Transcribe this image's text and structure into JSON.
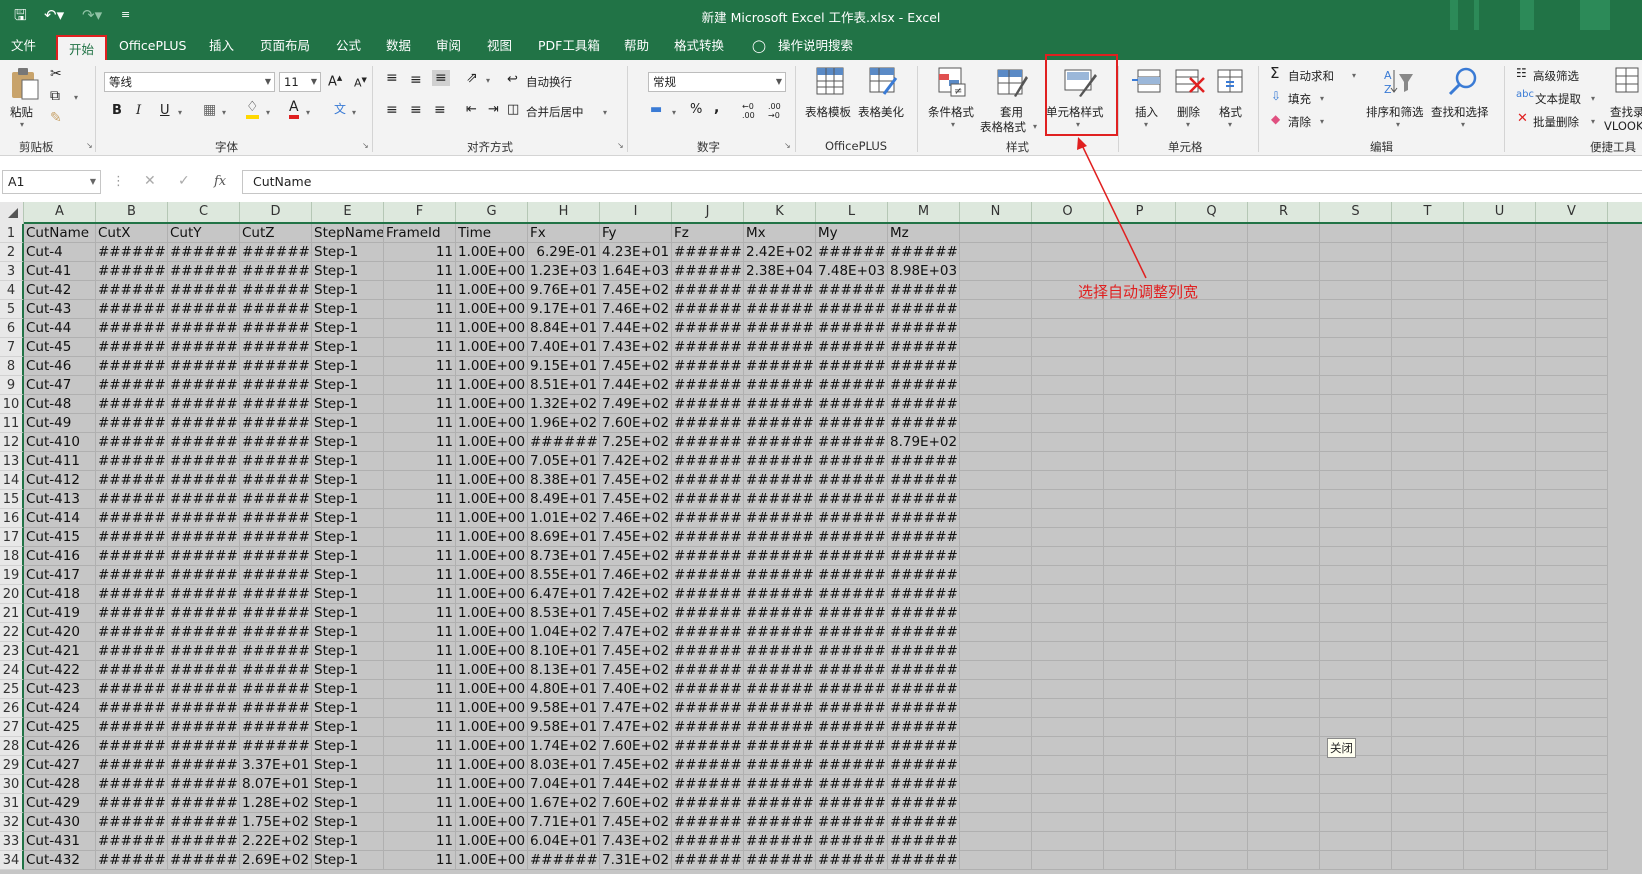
{
  "titlebar": {
    "title": "新建 Microsoft Excel 工作表.xlsx  -  Excel",
    "save_icon": "save-icon",
    "undo_icon": "undo-icon",
    "redo_icon": "redo-icon"
  },
  "tabs": [
    "文件",
    "开始",
    "OfficePLUS",
    "插入",
    "页面布局",
    "公式",
    "数据",
    "审阅",
    "视图",
    "PDF工具箱",
    "帮助",
    "格式转换"
  ],
  "tellme": "操作说明搜索",
  "ribbon": {
    "paste": "粘贴",
    "clipboard": "剪贴板",
    "font_name": "等线",
    "font_size": "11",
    "font_group": "字体",
    "wrap_text": "自动换行",
    "merge_center": "合并后居中",
    "align_group": "对齐方式",
    "number_format": "常规",
    "number_group": "数字",
    "table_template": "表格模板",
    "table_beautify": "表格美化",
    "officeplus_group": "OfficePLUS",
    "cond_format": "条件格式",
    "apply_format_1": "套用",
    "apply_format_2": "表格格式",
    "cell_styles": "单元格样式",
    "styles_group": "样式",
    "insert": "插入",
    "delete": "删除",
    "format": "格式",
    "cells_group": "单元格",
    "autosum": "自动求和",
    "fill": "填充",
    "clear": "清除",
    "sort_filter": "排序和筛选",
    "find_select": "查找和选择",
    "edit_group": "编辑",
    "adv_filter": "高级筛选",
    "text_extract": "文本提取",
    "batch_delete": "批量删除",
    "find_vlookup_1": "查找录",
    "find_vlookup_2": "VLOOK",
    "tools_group": "便捷工具"
  },
  "formula_bar": {
    "name_box": "A1",
    "fx_label": "fx",
    "content": "CutName"
  },
  "columns": [
    "A",
    "B",
    "C",
    "D",
    "E",
    "F",
    "G",
    "H",
    "I",
    "J",
    "K",
    "L",
    "M",
    "N",
    "O",
    "P",
    "Q",
    "R",
    "S",
    "T",
    "U",
    "V"
  ],
  "sheet": {
    "header": [
      "CutName",
      "CutX",
      "CutY",
      "CutZ",
      "StepName",
      "FrameId",
      "Time",
      "Fx",
      "Fy",
      "Fz",
      "Mx",
      "My",
      "Mz"
    ],
    "rows": [
      [
        "Cut-4",
        "#######",
        "#######",
        "#######",
        "Step-1",
        "11",
        "1.00E+00",
        "6.29E-01",
        "4.23E+01",
        "#######",
        "2.42E+02",
        "#######",
        "#######"
      ],
      [
        "Cut-41",
        "#######",
        "#######",
        "#######",
        "Step-1",
        "11",
        "1.00E+00",
        "1.23E+03",
        "1.64E+03",
        "#######",
        "2.38E+04",
        "7.48E+03",
        "8.98E+03"
      ],
      [
        "Cut-42",
        "#######",
        "#######",
        "#######",
        "Step-1",
        "11",
        "1.00E+00",
        "9.76E+01",
        "7.45E+02",
        "#######",
        "#######",
        "#######",
        "#######"
      ],
      [
        "Cut-43",
        "#######",
        "#######",
        "#######",
        "Step-1",
        "11",
        "1.00E+00",
        "9.17E+01",
        "7.46E+02",
        "#######",
        "#######",
        "#######",
        "#######"
      ],
      [
        "Cut-44",
        "#######",
        "#######",
        "#######",
        "Step-1",
        "11",
        "1.00E+00",
        "8.84E+01",
        "7.44E+02",
        "#######",
        "#######",
        "#######",
        "#######"
      ],
      [
        "Cut-45",
        "#######",
        "#######",
        "#######",
        "Step-1",
        "11",
        "1.00E+00",
        "7.40E+01",
        "7.43E+02",
        "#######",
        "#######",
        "#######",
        "#######"
      ],
      [
        "Cut-46",
        "#######",
        "#######",
        "#######",
        "Step-1",
        "11",
        "1.00E+00",
        "9.15E+01",
        "7.45E+02",
        "#######",
        "#######",
        "#######",
        "#######"
      ],
      [
        "Cut-47",
        "#######",
        "#######",
        "#######",
        "Step-1",
        "11",
        "1.00E+00",
        "8.51E+01",
        "7.44E+02",
        "#######",
        "#######",
        "#######",
        "#######"
      ],
      [
        "Cut-48",
        "#######",
        "#######",
        "#######",
        "Step-1",
        "11",
        "1.00E+00",
        "1.32E+02",
        "7.49E+02",
        "#######",
        "#######",
        "#######",
        "#######"
      ],
      [
        "Cut-49",
        "#######",
        "#######",
        "#######",
        "Step-1",
        "11",
        "1.00E+00",
        "1.96E+02",
        "7.60E+02",
        "#######",
        "#######",
        "#######",
        "#######"
      ],
      [
        "Cut-410",
        "#######",
        "#######",
        "#######",
        "Step-1",
        "11",
        "1.00E+00",
        "#######",
        "7.25E+02",
        "#######",
        "#######",
        "#######",
        "8.79E+02"
      ],
      [
        "Cut-411",
        "#######",
        "#######",
        "#######",
        "Step-1",
        "11",
        "1.00E+00",
        "7.05E+01",
        "7.42E+02",
        "#######",
        "#######",
        "#######",
        "#######"
      ],
      [
        "Cut-412",
        "#######",
        "#######",
        "#######",
        "Step-1",
        "11",
        "1.00E+00",
        "8.38E+01",
        "7.45E+02",
        "#######",
        "#######",
        "#######",
        "#######"
      ],
      [
        "Cut-413",
        "#######",
        "#######",
        "#######",
        "Step-1",
        "11",
        "1.00E+00",
        "8.49E+01",
        "7.45E+02",
        "#######",
        "#######",
        "#######",
        "#######"
      ],
      [
        "Cut-414",
        "#######",
        "#######",
        "#######",
        "Step-1",
        "11",
        "1.00E+00",
        "1.01E+02",
        "7.46E+02",
        "#######",
        "#######",
        "#######",
        "#######"
      ],
      [
        "Cut-415",
        "#######",
        "#######",
        "#######",
        "Step-1",
        "11",
        "1.00E+00",
        "8.69E+01",
        "7.45E+02",
        "#######",
        "#######",
        "#######",
        "#######"
      ],
      [
        "Cut-416",
        "#######",
        "#######",
        "#######",
        "Step-1",
        "11",
        "1.00E+00",
        "8.73E+01",
        "7.45E+02",
        "#######",
        "#######",
        "#######",
        "#######"
      ],
      [
        "Cut-417",
        "#######",
        "#######",
        "#######",
        "Step-1",
        "11",
        "1.00E+00",
        "8.55E+01",
        "7.46E+02",
        "#######",
        "#######",
        "#######",
        "#######"
      ],
      [
        "Cut-418",
        "#######",
        "#######",
        "#######",
        "Step-1",
        "11",
        "1.00E+00",
        "6.47E+01",
        "7.42E+02",
        "#######",
        "#######",
        "#######",
        "#######"
      ],
      [
        "Cut-419",
        "#######",
        "#######",
        "#######",
        "Step-1",
        "11",
        "1.00E+00",
        "8.53E+01",
        "7.45E+02",
        "#######",
        "#######",
        "#######",
        "#######"
      ],
      [
        "Cut-420",
        "#######",
        "#######",
        "#######",
        "Step-1",
        "11",
        "1.00E+00",
        "1.04E+02",
        "7.47E+02",
        "#######",
        "#######",
        "#######",
        "#######"
      ],
      [
        "Cut-421",
        "#######",
        "#######",
        "#######",
        "Step-1",
        "11",
        "1.00E+00",
        "8.10E+01",
        "7.45E+02",
        "#######",
        "#######",
        "#######",
        "#######"
      ],
      [
        "Cut-422",
        "#######",
        "#######",
        "#######",
        "Step-1",
        "11",
        "1.00E+00",
        "8.13E+01",
        "7.45E+02",
        "#######",
        "#######",
        "#######",
        "#######"
      ],
      [
        "Cut-423",
        "#######",
        "#######",
        "#######",
        "Step-1",
        "11",
        "1.00E+00",
        "4.80E+01",
        "7.40E+02",
        "#######",
        "#######",
        "#######",
        "#######"
      ],
      [
        "Cut-424",
        "#######",
        "#######",
        "#######",
        "Step-1",
        "11",
        "1.00E+00",
        "9.58E+01",
        "7.47E+02",
        "#######",
        "#######",
        "#######",
        "#######"
      ],
      [
        "Cut-425",
        "#######",
        "#######",
        "#######",
        "Step-1",
        "11",
        "1.00E+00",
        "9.58E+01",
        "7.47E+02",
        "#######",
        "#######",
        "#######",
        "#######"
      ],
      [
        "Cut-426",
        "#######",
        "#######",
        "#######",
        "Step-1",
        "11",
        "1.00E+00",
        "1.74E+02",
        "7.60E+02",
        "#######",
        "#######",
        "#######",
        "#######"
      ],
      [
        "Cut-427",
        "#######",
        "#######",
        "3.37E+01",
        "Step-1",
        "11",
        "1.00E+00",
        "8.03E+01",
        "7.45E+02",
        "#######",
        "#######",
        "#######",
        "#######"
      ],
      [
        "Cut-428",
        "#######",
        "#######",
        "8.07E+01",
        "Step-1",
        "11",
        "1.00E+00",
        "7.04E+01",
        "7.44E+02",
        "#######",
        "#######",
        "#######",
        "#######"
      ],
      [
        "Cut-429",
        "#######",
        "#######",
        "1.28E+02",
        "Step-1",
        "11",
        "1.00E+00",
        "1.67E+02",
        "7.60E+02",
        "#######",
        "#######",
        "#######",
        "#######"
      ],
      [
        "Cut-430",
        "#######",
        "#######",
        "1.75E+02",
        "Step-1",
        "11",
        "1.00E+00",
        "7.71E+01",
        "7.45E+02",
        "#######",
        "#######",
        "#######",
        "#######"
      ],
      [
        "Cut-431",
        "#######",
        "#######",
        "2.22E+02",
        "Step-1",
        "11",
        "1.00E+00",
        "6.04E+01",
        "7.43E+02",
        "#######",
        "#######",
        "#######",
        "#######"
      ],
      [
        "Cut-432",
        "#######",
        "#######",
        "2.69E+02",
        "Step-1",
        "11",
        "1.00E+00",
        "#######",
        "7.31E+02",
        "#######",
        "#######",
        "#######",
        "#######"
      ]
    ]
  },
  "annotation": "选择自动调整列宽",
  "tooltip": "关闭",
  "colors": {
    "excel_green": "#217346",
    "highlight_red": "#e02020",
    "sheet_background": "#c6c6c6"
  }
}
